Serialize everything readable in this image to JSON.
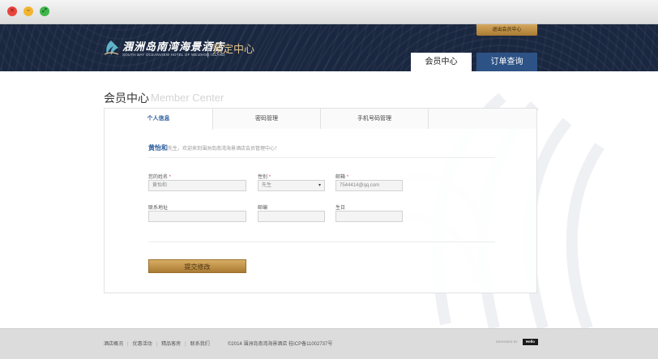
{
  "window": {
    "close_glyph": "✕",
    "minimize_glyph": "–",
    "maximize_glyph": "⤢"
  },
  "header": {
    "logout_label": "退出会员中心",
    "logo_cn": "涠洲岛南湾海景酒店",
    "logo_en": "SOUTH BAY OCEANVIEW HOTEL OF WEIZHOU ISLAND",
    "logo_sub": "預定中心",
    "tabs": [
      {
        "label": "会员中心",
        "active": true
      },
      {
        "label": "订单查询",
        "active": false
      }
    ]
  },
  "page": {
    "title": "会员中心",
    "title_en": "Member Center"
  },
  "panel": {
    "tabs": [
      {
        "label": "个人信息",
        "active": true
      },
      {
        "label": "密码管理",
        "active": false
      },
      {
        "label": "手机号码管理",
        "active": false
      },
      {
        "label": "",
        "active": false
      }
    ],
    "welcome": {
      "name": "黄怡和",
      "salutation": "先生，欢迎来到涠洲岛南湾海景酒店会员管理中心！"
    },
    "form": {
      "name": {
        "label": "您的姓名",
        "required": "*",
        "value": "黄怡和"
      },
      "gender": {
        "label": "性别",
        "required": "*",
        "value": "先生",
        "arrow": "▾"
      },
      "email": {
        "label": "邮箱",
        "required": "*",
        "value": "7544414@qq.com"
      },
      "address": {
        "label": "联系地址",
        "value": ""
      },
      "postcode": {
        "label": "邮编",
        "value": ""
      },
      "birthday": {
        "label": "生日",
        "value": ""
      },
      "submit_label": "提交修改"
    }
  },
  "footer": {
    "links": [
      "酒店概况",
      "优惠活动",
      "精品客房",
      "联系我们"
    ],
    "copyright": "©2014 涠洲岛南湾海景酒店 桂ICP备11002737号",
    "designed_by": "DESIGNED BY",
    "designer": "Hello"
  },
  "colors": {
    "header_bg": "#1a2740",
    "gold": "#c4934a",
    "accent_blue": "#2f5fa0",
    "tab_blue": "#2d5386"
  }
}
